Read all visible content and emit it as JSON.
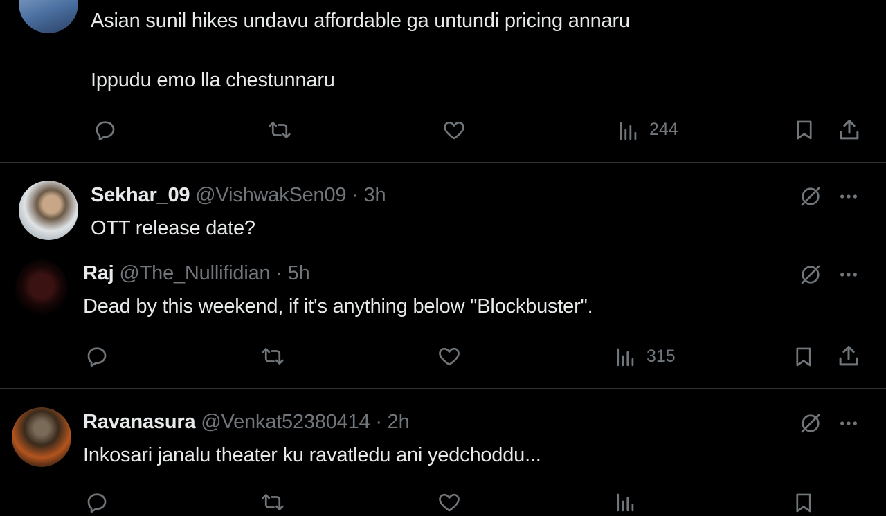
{
  "posts": [
    {
      "text_line1": "Asian sunil hikes undavu affordable ga untundi pricing annaru",
      "text_line2": "Ippudu emo lla chestunnaru",
      "views": "244"
    },
    {
      "name": "Sekhar_09",
      "handle": "@VishwakSen09",
      "sep": "·",
      "time": "3h",
      "text": "OTT release date?"
    },
    {
      "name": "Raj",
      "handle": "@The_Nullifidian",
      "sep": "·",
      "time": "5h",
      "text": "Dead by this weekend, if it's anything below \"Blockbuster\".",
      "views": "315"
    },
    {
      "name": "Ravanasura",
      "handle": "@Venkat52380414",
      "sep": "·",
      "time": "2h",
      "text": "Inkosari janalu theater ku ravatledu ani yedchoddu..."
    }
  ],
  "colors": {
    "background": "#000000",
    "text": "#e7e9ea",
    "muted": "#71767b",
    "divider": "#2f3336"
  },
  "icons": [
    "reply-icon",
    "repost-icon",
    "like-icon",
    "views-icon",
    "bookmark-icon",
    "share-icon",
    "grok-icon",
    "more-icon"
  ]
}
